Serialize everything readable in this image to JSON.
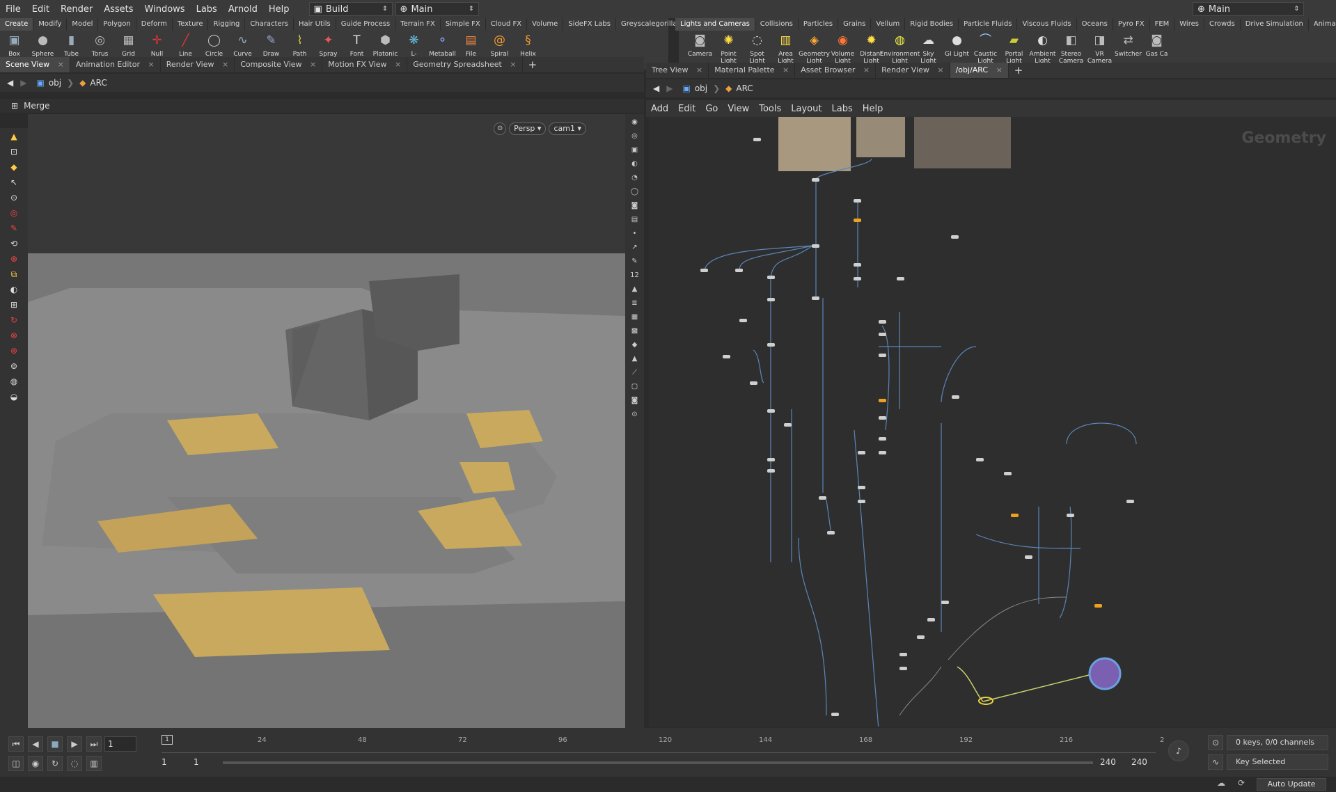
{
  "menubar": {
    "items": [
      "File",
      "Edit",
      "Render",
      "Assets",
      "Windows",
      "Labs",
      "Arnold",
      "Help"
    ],
    "desktop": "Build",
    "workspace": "Main",
    "workspace_right": "Main"
  },
  "shelf_left": {
    "tabs": [
      "Create",
      "Modify",
      "Model",
      "Polygon",
      "Deform",
      "Texture",
      "Rigging",
      "Characters",
      "Hair Utils",
      "Guide Process",
      "Terrain FX",
      "Simple FX",
      "Cloud FX",
      "Volume",
      "SideFX Labs",
      "Greyscalegorilla"
    ],
    "tools": [
      {
        "label": "Box",
        "icon": "box-icon",
        "color": "#9ab"
      },
      {
        "label": "Sphere",
        "icon": "sphere-icon",
        "color": "#bbb"
      },
      {
        "label": "Tube",
        "icon": "tube-icon",
        "color": "#9ab"
      },
      {
        "label": "Torus",
        "icon": "torus-icon",
        "color": "#bbb"
      },
      {
        "label": "Grid",
        "icon": "grid-icon",
        "color": "#bbb"
      },
      {
        "label": "Null",
        "icon": "null-icon",
        "color": "#e33"
      },
      {
        "label": "Line",
        "icon": "line-icon",
        "color": "#e33"
      },
      {
        "label": "Circle",
        "icon": "circle-icon",
        "color": "#bbb"
      },
      {
        "label": "Curve Bezier",
        "icon": "curve-bezier-icon",
        "color": "#9ac"
      },
      {
        "label": "Draw Curve",
        "icon": "draw-curve-icon",
        "color": "#9ac"
      },
      {
        "label": "Path",
        "icon": "path-icon",
        "color": "#dc4"
      },
      {
        "label": "Spray Paint",
        "icon": "spray-paint-icon",
        "color": "#e55"
      },
      {
        "label": "Font",
        "icon": "font-icon",
        "color": "#ddd"
      },
      {
        "label": "Platonic Solids",
        "icon": "platonic-icon",
        "color": "#bbb"
      },
      {
        "label": "L-System",
        "icon": "lsystem-icon",
        "color": "#6bd"
      },
      {
        "label": "Metaball",
        "icon": "metaball-icon",
        "color": "#8af"
      },
      {
        "label": "File",
        "icon": "file-icon",
        "color": "#e84"
      },
      {
        "label": "Spiral",
        "icon": "spiral-icon",
        "color": "#e93"
      },
      {
        "label": "Helix",
        "icon": "helix-icon",
        "color": "#e93"
      }
    ]
  },
  "shelf_right": {
    "tabs": [
      "Lights and Cameras",
      "Collisions",
      "Particles",
      "Grains",
      "Vellum",
      "Rigid Bodies",
      "Particle Fluids",
      "Viscous Fluids",
      "Oceans",
      "Pyro FX",
      "FEM",
      "Wires",
      "Crowds",
      "Drive Simulation",
      "Animation",
      "Arnold"
    ],
    "tools": [
      {
        "label": "Camera",
        "icon": "camera-icon",
        "color": "#bbb"
      },
      {
        "label": "Point Light",
        "icon": "point-light-icon",
        "color": "#fd4"
      },
      {
        "label": "Spot Light",
        "icon": "spot-light-icon",
        "color": "#ddd"
      },
      {
        "label": "Area Light",
        "icon": "area-light-icon",
        "color": "#fd4"
      },
      {
        "label": "Geometry Light",
        "icon": "geometry-light-icon",
        "color": "#fa3"
      },
      {
        "label": "Volume Light",
        "icon": "volume-light-icon",
        "color": "#f73"
      },
      {
        "label": "Distant Light",
        "icon": "distant-light-icon",
        "color": "#fd4"
      },
      {
        "label": "Environment Light",
        "icon": "environment-light-icon",
        "color": "#ee4"
      },
      {
        "label": "Sky Light",
        "icon": "sky-light-icon",
        "color": "#ddd"
      },
      {
        "label": "GI Light",
        "icon": "gi-light-icon",
        "color": "#ddd"
      },
      {
        "label": "Caustic Light",
        "icon": "caustic-light-icon",
        "color": "#9cf"
      },
      {
        "label": "Portal Light",
        "icon": "portal-light-icon",
        "color": "#cc3"
      },
      {
        "label": "Ambient Light",
        "icon": "ambient-light-icon",
        "color": "#ddd"
      },
      {
        "label": "Stereo Camera",
        "icon": "stereo-camera-icon",
        "color": "#bbb"
      },
      {
        "label": "VR Camera",
        "icon": "vr-camera-icon",
        "color": "#bbb"
      },
      {
        "label": "Switcher",
        "icon": "switcher-icon",
        "color": "#bbb"
      },
      {
        "label": "Gas Ca",
        "icon": "gas-camera-icon",
        "color": "#bbb"
      }
    ]
  },
  "left_pane": {
    "tabs": [
      "Scene View",
      "Animation Editor",
      "Render View",
      "Composite View",
      "Motion FX View",
      "Geometry Spreadsheet"
    ],
    "path_root": "obj",
    "path_node": "ARC",
    "op_name": "Merge",
    "view": "Persp",
    "camera": "cam1"
  },
  "right_pane": {
    "tabs": [
      "Tree View",
      "Material Palette",
      "Asset Browser",
      "Render View",
      "/obj/ARC"
    ],
    "path_root": "obj",
    "path_node": "ARC",
    "menu": [
      "Add",
      "Edit",
      "Go",
      "View",
      "Tools",
      "Layout",
      "Labs",
      "Help"
    ],
    "context_label": "Geometry"
  },
  "timeline": {
    "ticks": [
      "24",
      "48",
      "72",
      "96",
      "120",
      "144",
      "168",
      "192",
      "216",
      "2"
    ],
    "current_frame": "1",
    "frame_marker": "1",
    "range_start": "1",
    "range_start2": "1",
    "range_end": "240",
    "range_end2": "240",
    "keys_info": "0 keys, 0/0 channels",
    "key_mode": "Key Selected",
    "auto_update": "Auto Update"
  }
}
